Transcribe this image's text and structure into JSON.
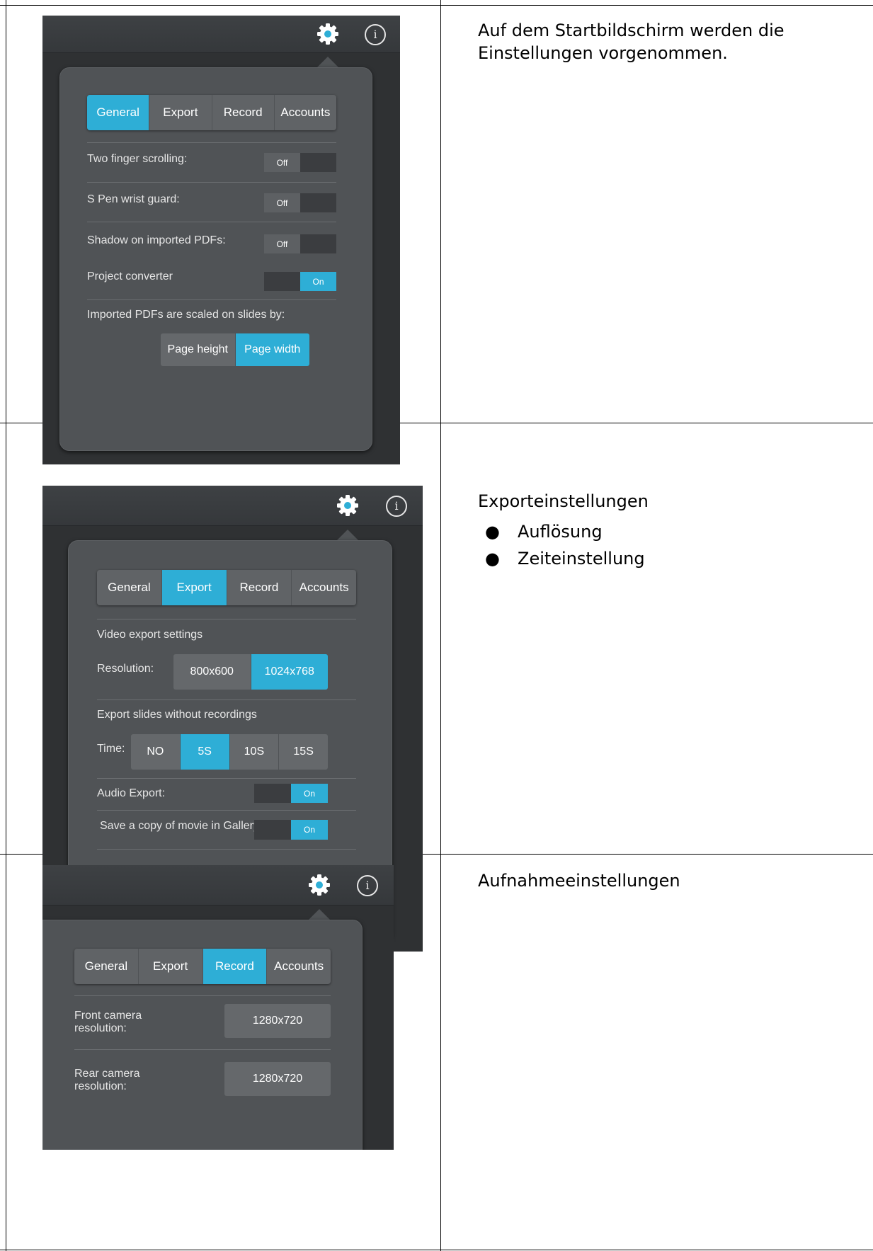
{
  "rows": [
    {
      "description": "Auf dem Startbildschirm werden die Einstellungen vorgenommen.",
      "screenshot": {
        "tabs": [
          {
            "label": "General",
            "active": true
          },
          {
            "label": "Export",
            "active": false
          },
          {
            "label": "Record",
            "active": false
          },
          {
            "label": "Accounts",
            "active": false
          }
        ],
        "settings": [
          {
            "label": "Two finger scrolling:",
            "state": "Off"
          },
          {
            "label": "S Pen wrist guard:",
            "state": "Off"
          },
          {
            "label": "Shadow on imported PDFs:",
            "state": "Off"
          },
          {
            "label": "Project converter",
            "state": "On"
          }
        ],
        "scale_label": "Imported PDFs are scaled on slides by:",
        "scale_options": [
          {
            "label": "Page height",
            "active": false
          },
          {
            "label": "Page width",
            "active": true
          }
        ]
      }
    },
    {
      "description": "Exporteinstellungen",
      "bullets": [
        "Auflösung",
        "Zeiteinstellung"
      ],
      "screenshot": {
        "tabs": [
          {
            "label": "General",
            "active": false
          },
          {
            "label": "Export",
            "active": true
          },
          {
            "label": "Record",
            "active": false
          },
          {
            "label": "Accounts",
            "active": false
          }
        ],
        "video_heading": "Video export settings",
        "resolution_label": "Resolution:",
        "resolution_options": [
          {
            "label": "800x600",
            "active": false
          },
          {
            "label": "1024x768",
            "active": true
          }
        ],
        "slides_heading": "Export slides without recordings",
        "time_label": "Time:",
        "time_options": [
          {
            "label": "NO",
            "active": false
          },
          {
            "label": "5S",
            "active": true
          },
          {
            "label": "10S",
            "active": false
          },
          {
            "label": "15S",
            "active": false
          }
        ],
        "settings": [
          {
            "label": "Audio Export:",
            "state": "On"
          },
          {
            "label": "Save a copy of movie in Gallery",
            "state": "On"
          }
        ]
      }
    },
    {
      "description": "Aufnahmeeinstellungen",
      "screenshot": {
        "tabs": [
          {
            "label": "General",
            "active": false
          },
          {
            "label": "Export",
            "active": false
          },
          {
            "label": "Record",
            "active": true
          },
          {
            "label": "Accounts",
            "active": false
          }
        ],
        "front_label_line1": "Front camera",
        "front_label_line2": "resolution:",
        "front_value": "1280x720",
        "rear_label_line1": "Rear camera",
        "rear_label_line2": "resolution:",
        "rear_value": "1280x720"
      }
    }
  ],
  "icons": {
    "settings": "gear-icon",
    "info": "info-icon",
    "info_glyph": "i"
  },
  "colors": {
    "accent": "#2eaed6",
    "panel": "#505356",
    "background": "#2f3133"
  }
}
